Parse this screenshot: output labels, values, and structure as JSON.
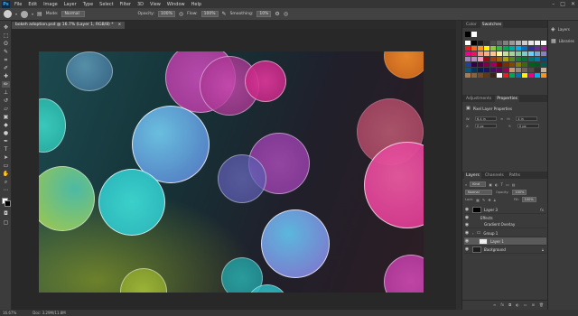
{
  "menubar": {
    "logo": "Ps",
    "items": [
      "File",
      "Edit",
      "Image",
      "Layer",
      "Type",
      "Select",
      "Filter",
      "3D",
      "View",
      "Window",
      "Help"
    ],
    "window_controls": [
      "–",
      "□",
      "✕"
    ]
  },
  "options": {
    "mode_label": "Mode:",
    "mode_value": "Normal",
    "opacity_label": "Opacity:",
    "opacity_value": "100%",
    "flow_label": "Flow:",
    "flow_value": "100%",
    "smoothing_label": "Smoothing:",
    "smoothing_value": "10%"
  },
  "document": {
    "tab_title": "bokeh adoption.psd @ 16.7% (Layer 1, RGB/8) *",
    "tab_close": "×"
  },
  "statusbar": {
    "zoom": "16.67%",
    "doc_size": "Doc: 3.29M/11.8M"
  },
  "swatches": {
    "tabs": [
      "Color",
      "Swatches"
    ],
    "colors": [
      "#ffffff",
      "#000000",
      "#1a1a1a",
      "#333333",
      "#4d4d4d",
      "#666666",
      "#808080",
      "#999999",
      "#b3b3b3",
      "#cccccc",
      "#e6e6e6",
      "#f2f2f2",
      "#ffffff",
      "#ed1c24",
      "#f26522",
      "#f7941d",
      "#fff200",
      "#8dc63f",
      "#39b54a",
      "#00a651",
      "#00a99d",
      "#00aeef",
      "#0072bc",
      "#2e3192",
      "#662d91",
      "#92278f",
      "#ec008c",
      "#ed145b",
      "#f69679",
      "#f9ad81",
      "#fdc689",
      "#fff799",
      "#c4df9b",
      "#a3d39c",
      "#82ca9c",
      "#7accc8",
      "#6dcff6",
      "#7da7d9",
      "#8781bd",
      "#a186be",
      "#bd8cbf",
      "#f49ac1",
      "#9e0b0f",
      "#a0410d",
      "#a36209",
      "#aba000",
      "#598527",
      "#1a7b30",
      "#007236",
      "#00746b",
      "#0076a3",
      "#004b80",
      "#21409a",
      "#32004b",
      "#4b0049",
      "#7b0046",
      "#9e005d",
      "#790000",
      "#7b2e00",
      "#7d4900",
      "#827b00",
      "#406618",
      "#005e20",
      "#005826",
      "#005952",
      "#005b7f",
      "#003663",
      "#002157",
      "#1b1464",
      "#440e62",
      "#630460",
      "#9e005d",
      "#c69c6d",
      "#998675",
      "#736357",
      "#534741",
      "#362f2d",
      "#c7b299",
      "#a67c52",
      "#8c6239",
      "#754c24",
      "#603913",
      "#3c2415",
      "#ffffff",
      "#ed1c24",
      "#00a651",
      "#0072bc",
      "#fff200",
      "#ec008c",
      "#00aeef",
      "#f7941d"
    ]
  },
  "properties": {
    "tabs": [
      "Adjustments",
      "Properties"
    ],
    "title": "Pixel Layer Properties",
    "w_label": "W:",
    "w_value": "6.4 in",
    "h_label": "H:",
    "h_value": "4 in",
    "x_label": "X:",
    "x_value": "0 px",
    "y_label": "Y:",
    "y_value": "0 px"
  },
  "layers": {
    "tabs": [
      "Layers",
      "Channels",
      "Paths"
    ],
    "kind_label": "Kind",
    "blend_mode": "Normal",
    "opacity_label": "Opacity:",
    "opacity_value": "100%",
    "lock_label": "Lock:",
    "fill_label": "Fill:",
    "fill_value": "100%",
    "items": [
      {
        "name": "Layer 3",
        "selected": false
      },
      {
        "name": "Effects",
        "selected": false
      },
      {
        "name": "Gradient Overlay",
        "selected": false
      },
      {
        "name": "Group 1",
        "selected": false
      },
      {
        "name": "Layer 1",
        "selected": true
      },
      {
        "name": "Background",
        "selected": false
      }
    ]
  },
  "side_panels": {
    "items": [
      {
        "label": "Layers",
        "icon": "layers-icon"
      },
      {
        "label": "Libraries",
        "icon": "libraries-icon"
      }
    ]
  },
  "colors": {
    "accent": "#3fa9f5",
    "selected_layer": "#5a5a5a",
    "foreground": "#ffffff",
    "background": "#000000"
  }
}
